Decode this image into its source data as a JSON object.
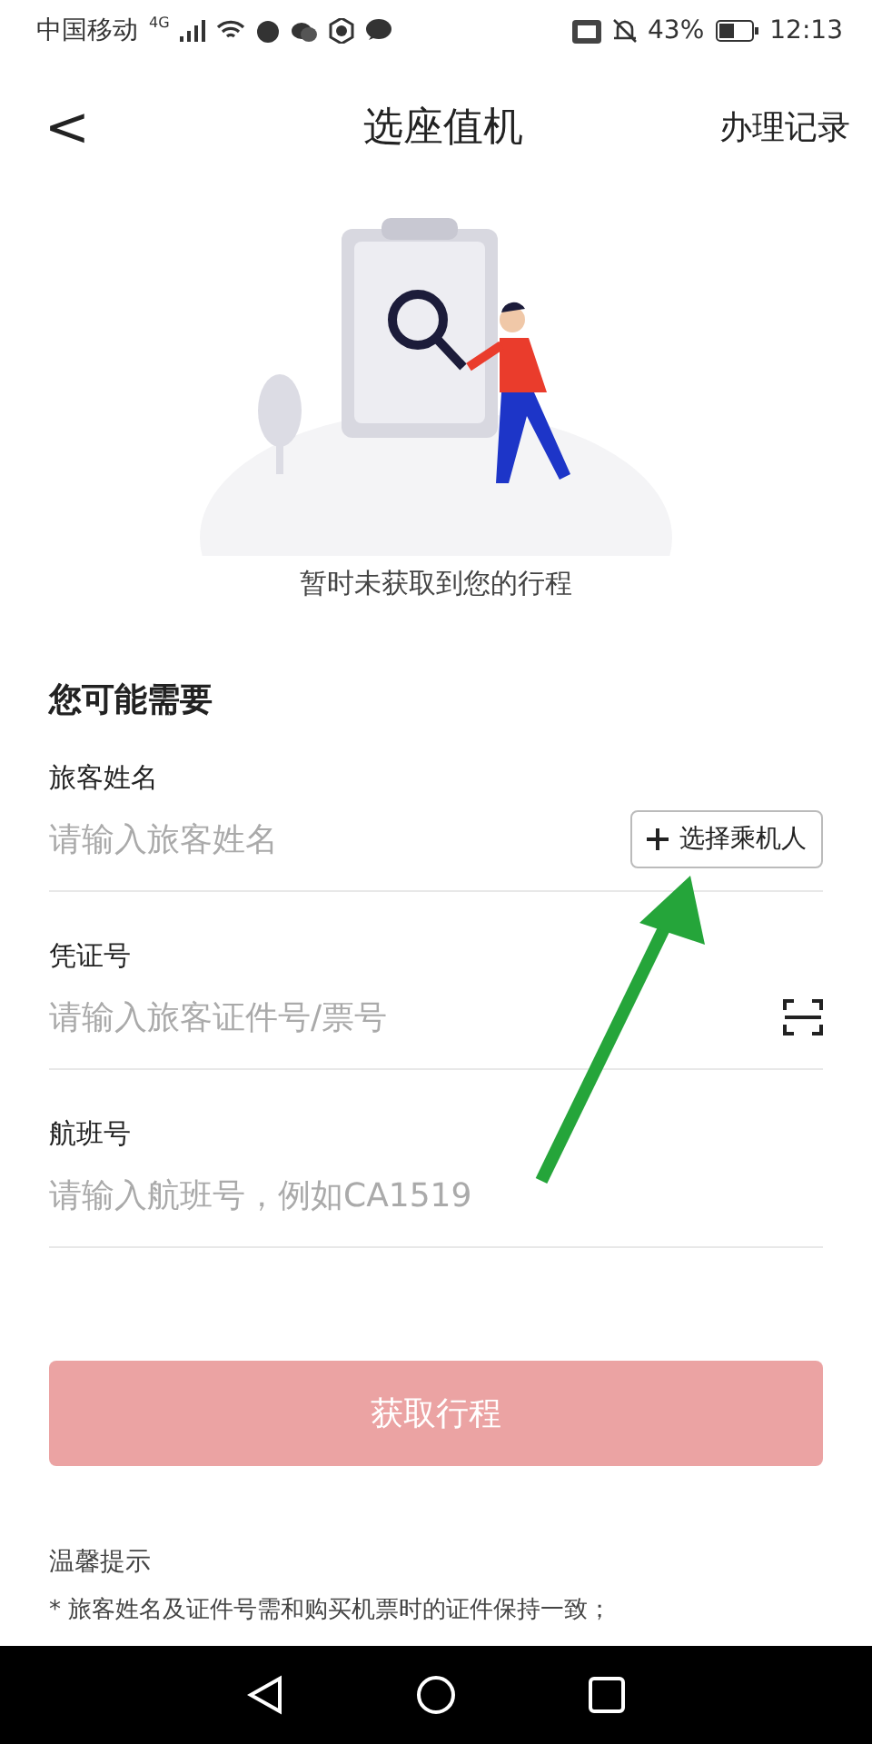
{
  "status_bar": {
    "carrier": "中国移动",
    "network": "4G",
    "battery_percent": "43%",
    "time": "12:13"
  },
  "header": {
    "back": "<",
    "title": "选座值机",
    "action": "办理记录"
  },
  "empty_state": {
    "message": "暂时未获取到您的行程"
  },
  "section_title": "您可能需要",
  "fields": [
    {
      "label": "旅客姓名",
      "placeholder": "请输入旅客姓名",
      "kind": "picker",
      "button": "选择乘机人"
    },
    {
      "label": "凭证号",
      "placeholder": "请输入旅客证件号/票号",
      "kind": "scan"
    },
    {
      "label": "航班号",
      "placeholder": "请输入航班号，例如CA1519",
      "kind": "plain"
    }
  ],
  "submit": {
    "label": "获取行程",
    "disabled": true
  },
  "tips": {
    "title": "温馨提示",
    "lines": [
      "* 旅客姓名及证件号需和购买机票时的证件保持一致；"
    ]
  }
}
